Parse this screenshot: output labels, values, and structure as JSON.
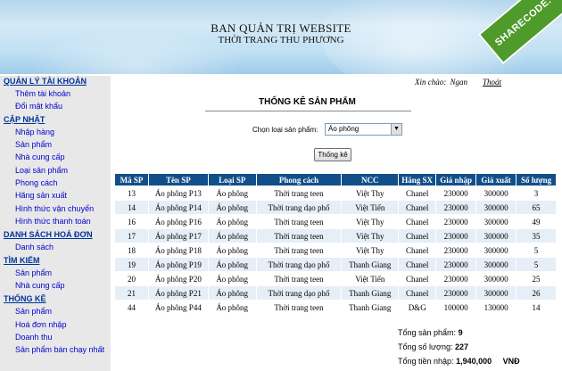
{
  "header": {
    "title": "BAN QUẢN TRỊ WEBSITE",
    "subtitle": "THỜI TRANG THU PHƯƠNG",
    "logo_text": "SHARECODE.vn"
  },
  "sidebar": {
    "sections": [
      {
        "title": "QUẢN LÝ TÀI KHOẢN",
        "items": [
          "Thêm tài khoản",
          "Đổi mật khẩu"
        ]
      },
      {
        "title": "CẬP NHẬT",
        "items": [
          "Nhập hàng",
          "Sản phẩm",
          "Nhà cung cấp",
          "Loại sản phẩm",
          "Phong cách",
          "Hãng sản xuất",
          "Hình thức vận chuyển",
          "Hình thức thanh toán"
        ]
      },
      {
        "title": "DANH SÁCH HOÁ ĐƠN",
        "items": [
          "Danh sách"
        ]
      },
      {
        "title": "TÌM KIẾM",
        "items": [
          "Sản phẩm",
          "Nhà cung cấp"
        ]
      },
      {
        "title": "THỐNG KÊ",
        "items": [
          "Sản phẩm",
          "Hoá đơn nhập",
          "Doanh thu",
          "Sản phẩm bán chạy nhất"
        ]
      }
    ]
  },
  "greeting": {
    "label": "Xin chào:",
    "user": "Ngan",
    "logout": "Thoát"
  },
  "main": {
    "title": "THỐNG KÊ SẢN PHẨM",
    "category_label": "Chọn loại sản phẩm:",
    "category_value": "Áo phông",
    "button": "Thống kê"
  },
  "table": {
    "columns": [
      "Mã SP",
      "Tên SP",
      "Loại SP",
      "Phong cách",
      "NCC",
      "Hãng SX",
      "Giá nhập",
      "Giá xuất",
      "Số lượng"
    ],
    "rows": [
      [
        "13",
        "Áo phông P13",
        "Áo phông",
        "Thời trang teen",
        "Việt Thy",
        "Chanel",
        "230000",
        "300000",
        "3"
      ],
      [
        "14",
        "Áo phông P14",
        "Áo phông",
        "Thời trang dạo phố",
        "Việt Tiến",
        "Chanel",
        "230000",
        "300000",
        "65"
      ],
      [
        "16",
        "Áo phông P16",
        "Áo phông",
        "Thời trang teen",
        "Việt Thy",
        "Chanel",
        "230000",
        "300000",
        "49"
      ],
      [
        "17",
        "Áo phông P17",
        "Áo phông",
        "Thời trang teen",
        "Việt Thy",
        "Chanel",
        "230000",
        "300000",
        "35"
      ],
      [
        "18",
        "Áo phông P18",
        "Áo phông",
        "Thời trang teen",
        "Việt Thy",
        "Chanel",
        "230000",
        "300000",
        "5"
      ],
      [
        "19",
        "Áo phông P19",
        "Áo phông",
        "Thời trang dạo phố",
        "Thanh Giang",
        "Chanel",
        "230000",
        "300000",
        "5"
      ],
      [
        "20",
        "Áo phông P20",
        "Áo phông",
        "Thời trang teen",
        "Việt Tiến",
        "Chanel",
        "230000",
        "300000",
        "25"
      ],
      [
        "21",
        "Áo phông P21",
        "Áo phông",
        "Thời trang dạo phố",
        "Thanh Giang",
        "Chanel",
        "230000",
        "300000",
        "26"
      ],
      [
        "44",
        "Áo phông P44",
        "Áo phông",
        "Thời trang teen",
        "Thanh Giang",
        "D&G",
        "100000",
        "130000",
        "14"
      ]
    ]
  },
  "totals": {
    "products_label": "Tổng sản phẩm:",
    "products_value": "9",
    "quantity_label": "Tổng số lượng:",
    "quantity_value": "227",
    "import_label": "Tổng tiền nhập:",
    "import_value": "1,940,000",
    "currency": "VNĐ"
  }
}
